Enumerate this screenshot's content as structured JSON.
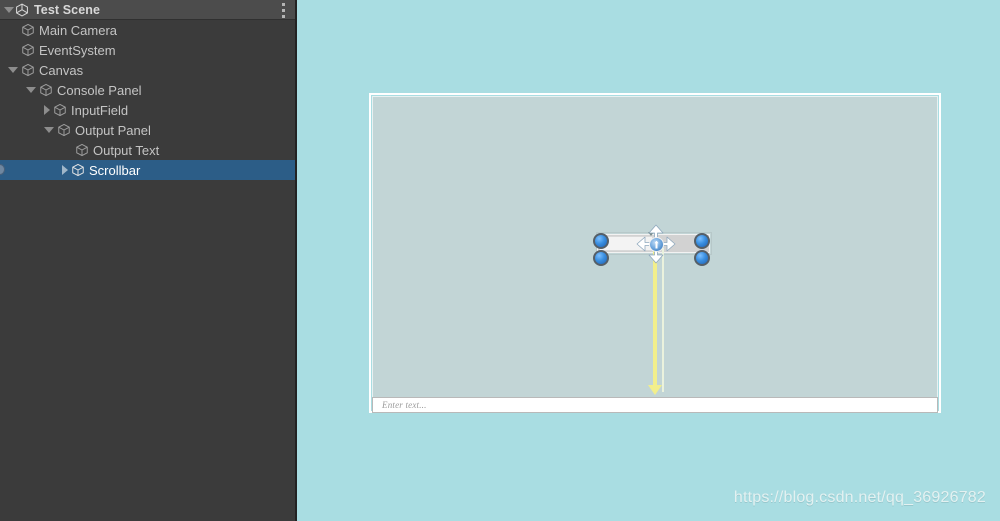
{
  "window": {
    "background_color": "#a9dde2"
  },
  "hierarchy": {
    "header": {
      "title": "Test Scene",
      "scene_icon": "unity-scene-icon",
      "menu_icon": "kebab-menu-icon",
      "expanded": true
    },
    "selection_color": "#2c5d87",
    "rows": [
      {
        "label": "Main Camera",
        "depth": 1,
        "toggle": "none",
        "icon": "gameobject-cube-icon",
        "selected": false
      },
      {
        "label": "EventSystem",
        "depth": 1,
        "toggle": "none",
        "icon": "gameobject-cube-icon",
        "selected": false
      },
      {
        "label": "Canvas",
        "depth": 1,
        "toggle": "expanded",
        "icon": "gameobject-cube-icon",
        "selected": false
      },
      {
        "label": "Console Panel",
        "depth": 2,
        "toggle": "expanded",
        "icon": "gameobject-cube-icon",
        "selected": false
      },
      {
        "label": "InputField",
        "depth": 3,
        "toggle": "collapsed",
        "icon": "gameobject-cube-icon",
        "selected": false
      },
      {
        "label": "Output Panel",
        "depth": 3,
        "toggle": "expanded",
        "icon": "gameobject-cube-icon",
        "selected": false
      },
      {
        "label": "Output Text",
        "depth": 4,
        "toggle": "none",
        "icon": "gameobject-cube-icon",
        "selected": false
      },
      {
        "label": "Scrollbar",
        "depth": 4,
        "toggle": "collapsed",
        "icon": "gameobject-cube-icon",
        "selected": true
      }
    ]
  },
  "scene_view": {
    "console_panel": {
      "name": "Console Panel",
      "border_color": "#ffffff"
    },
    "output_panel": {
      "name": "Output Panel",
      "fill_color": "#c2d5d6"
    },
    "input_field": {
      "name": "InputField",
      "placeholder": "Enter text...",
      "value": ""
    },
    "selected_object": {
      "name": "Scrollbar",
      "gizmo_tool": "move-tool",
      "handle_color": "#3a8fe0",
      "anchor_line_color": "#f2ef8c"
    }
  },
  "watermark": {
    "text": "https://blog.csdn.net/qq_36926782"
  }
}
